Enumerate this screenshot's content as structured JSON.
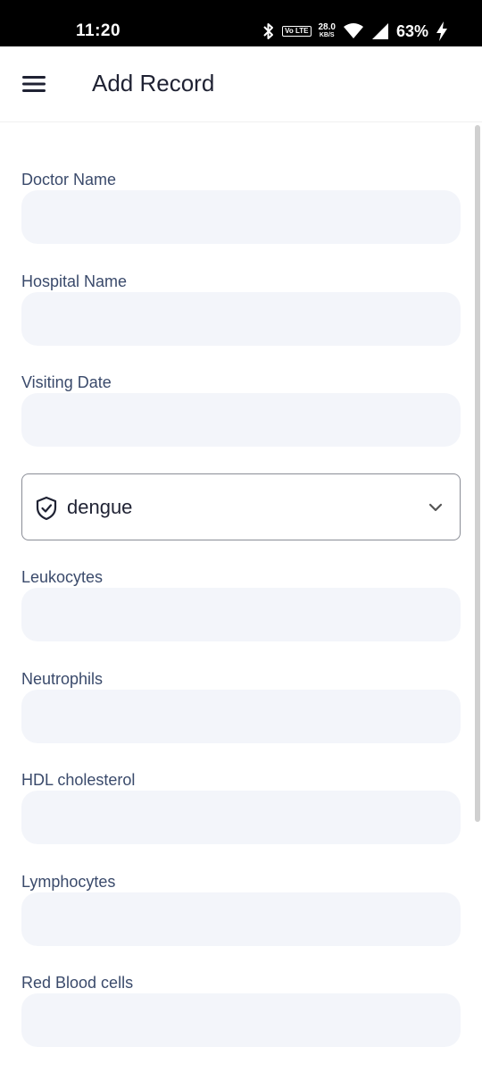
{
  "status_bar": {
    "time": "11:20",
    "volte": "Vo LTE",
    "speed_value": "28.0",
    "speed_unit": "KB/S",
    "battery": "63%"
  },
  "app_bar": {
    "title": "Add Record",
    "menu_icon": "hamburger-menu-icon"
  },
  "form": {
    "doctor_name": {
      "label": "Doctor Name",
      "value": ""
    },
    "hospital_name": {
      "label": "Hospital Name",
      "value": ""
    },
    "visiting_date": {
      "label": "Visiting Date",
      "value": ""
    },
    "disease_select": {
      "value": "dengue",
      "icon": "shield-check-icon"
    },
    "leukocytes": {
      "label": "Leukocytes",
      "value": ""
    },
    "neutrophils": {
      "label": "Neutrophils",
      "value": ""
    },
    "hdl_cholesterol": {
      "label": "HDL cholesterol",
      "value": ""
    },
    "lymphocytes": {
      "label": "Lymphocytes",
      "value": ""
    },
    "red_blood_cells": {
      "label": "Red Blood cells",
      "value": ""
    }
  },
  "colors": {
    "label": "#3a4a6b",
    "input_bg": "#f3f5fa",
    "title": "#1f2233"
  }
}
